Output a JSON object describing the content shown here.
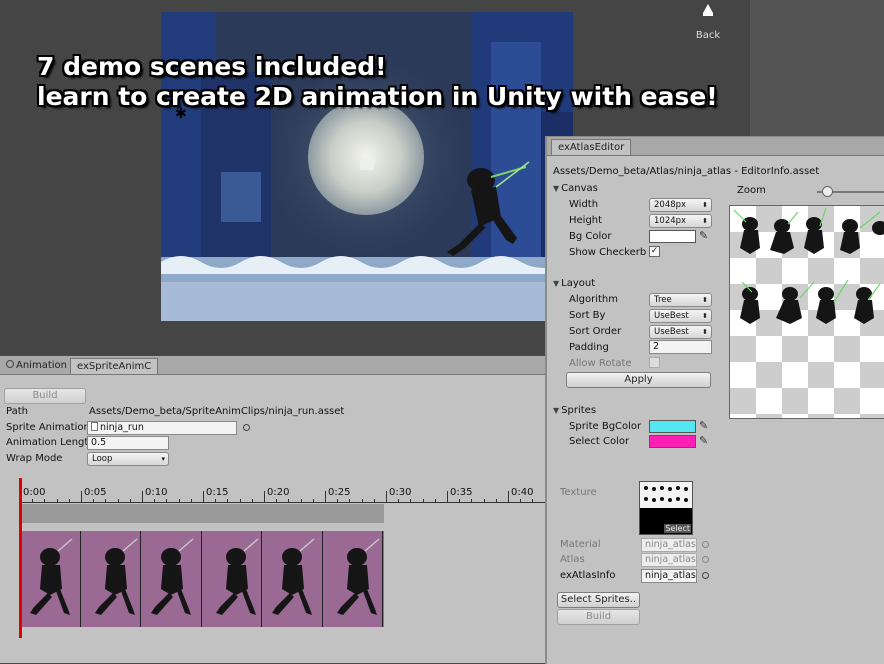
{
  "headline": {
    "line1": "7 demo scenes included!",
    "line2": "learn to create 2D animation in Unity with ease!"
  },
  "scene": {
    "back_label": "Back"
  },
  "anim_panel": {
    "tabs": [
      {
        "label": "Animation"
      },
      {
        "label": "exSpriteAnimC"
      }
    ],
    "build_label": "Build",
    "path_label": "Path",
    "path_value": "Assets/Demo_beta/SpriteAnimClips/ninja_run.asset",
    "sprite_anim_label": "Sprite Animatior",
    "sprite_anim_value": "ninja_run",
    "anim_length_label": "Animation Lengt",
    "anim_length_value": "0.5",
    "wrap_mode_label": "Wrap Mode",
    "wrap_mode_value": "Loop",
    "timeline_labels": [
      "0:00",
      "0:05",
      "0:10",
      "0:15",
      "0:20",
      "0:25",
      "0:30",
      "0:35",
      "0:40"
    ],
    "frame_count": 6
  },
  "atlas_editor": {
    "tab_label": "exAtlasEditor",
    "path": "Assets/Demo_beta/Atlas/ninja_atlas - EditorInfo.asset",
    "canvas": {
      "title": "Canvas",
      "width_label": "Width",
      "width_value": "2048px",
      "height_label": "Height",
      "height_value": "1024px",
      "bgcolor_label": "Bg Color",
      "show_checker_label": "Show Checkerb",
      "show_checker_checked": "✓"
    },
    "zoom_label": "Zoom",
    "layout": {
      "title": "Layout",
      "algorithm_label": "Algorithm",
      "algorithm_value": "Tree",
      "sortby_label": "Sort By",
      "sortby_value": "UseBest",
      "sortorder_label": "Sort Order",
      "sortorder_value": "UseBest",
      "padding_label": "Padding",
      "padding_value": "2",
      "allow_rotate_label": "Allow Rotate",
      "apply_label": "Apply"
    },
    "sprites": {
      "title": "Sprites",
      "bgcolor_label": "Sprite BgColor",
      "bgcolor": "#55e6f2",
      "select_color_label": "Select Color",
      "select_color": "#ff1fb4"
    },
    "texture_label": "Texture",
    "texture_select": "Select",
    "material_label": "Material",
    "material_value": "ninja_atlas",
    "atlas_label": "Atlas",
    "atlas_value": "ninja_atlas",
    "atlasinfo_label": "exAtlasInfo",
    "atlasinfo_value": "ninja_atlas",
    "select_sprites_label": "Select Sprites..",
    "build_label": "Build"
  },
  "colors": {
    "playhead": "#e00000",
    "frame_track": "#9a6a95"
  }
}
